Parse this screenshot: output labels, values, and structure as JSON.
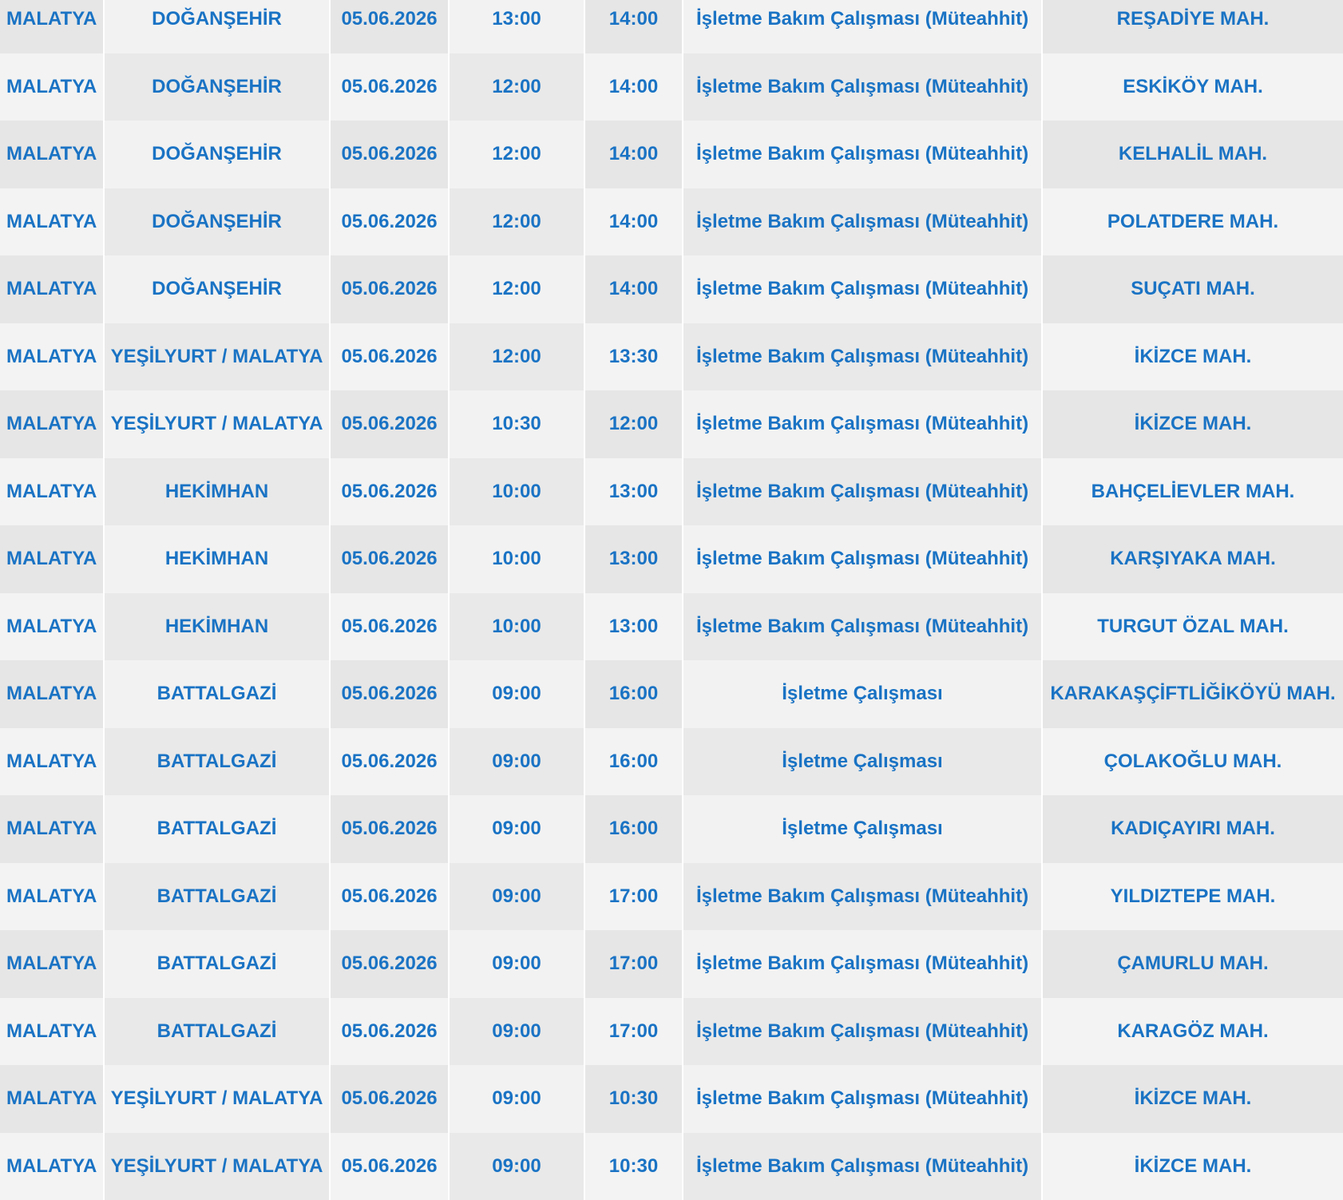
{
  "rows": [
    {
      "il": "MALATYA",
      "ilce": "DOĞANŞEHİR",
      "tarih": "05.06.2026",
      "baslangic": "13:00",
      "bitis": "14:00",
      "neden": "İşletme Bakım Çalışması (Müteahhit)",
      "mahalle": "REŞADİYE MAH."
    },
    {
      "il": "MALATYA",
      "ilce": "DOĞANŞEHİR",
      "tarih": "05.06.2026",
      "baslangic": "12:00",
      "bitis": "14:00",
      "neden": "İşletme Bakım Çalışması (Müteahhit)",
      "mahalle": "ESKİKÖY MAH."
    },
    {
      "il": "MALATYA",
      "ilce": "DOĞANŞEHİR",
      "tarih": "05.06.2026",
      "baslangic": "12:00",
      "bitis": "14:00",
      "neden": "İşletme Bakım Çalışması (Müteahhit)",
      "mahalle": "KELHALİL MAH."
    },
    {
      "il": "MALATYA",
      "ilce": "DOĞANŞEHİR",
      "tarih": "05.06.2026",
      "baslangic": "12:00",
      "bitis": "14:00",
      "neden": "İşletme Bakım Çalışması (Müteahhit)",
      "mahalle": "POLATDERE MAH."
    },
    {
      "il": "MALATYA",
      "ilce": "DOĞANŞEHİR",
      "tarih": "05.06.2026",
      "baslangic": "12:00",
      "bitis": "14:00",
      "neden": "İşletme Bakım Çalışması (Müteahhit)",
      "mahalle": "SUÇATI MAH."
    },
    {
      "il": "MALATYA",
      "ilce": "YEŞİLYURT / MALATYA",
      "tarih": "05.06.2026",
      "baslangic": "12:00",
      "bitis": "13:30",
      "neden": "İşletme Bakım Çalışması (Müteahhit)",
      "mahalle": "İKİZCE MAH."
    },
    {
      "il": "MALATYA",
      "ilce": "YEŞİLYURT / MALATYA",
      "tarih": "05.06.2026",
      "baslangic": "10:30",
      "bitis": "12:00",
      "neden": "İşletme Bakım Çalışması (Müteahhit)",
      "mahalle": "İKİZCE MAH."
    },
    {
      "il": "MALATYA",
      "ilce": "HEKİMHAN",
      "tarih": "05.06.2026",
      "baslangic": "10:00",
      "bitis": "13:00",
      "neden": "İşletme Bakım Çalışması (Müteahhit)",
      "mahalle": "BAHÇELİEVLER MAH."
    },
    {
      "il": "MALATYA",
      "ilce": "HEKİMHAN",
      "tarih": "05.06.2026",
      "baslangic": "10:00",
      "bitis": "13:00",
      "neden": "İşletme Bakım Çalışması (Müteahhit)",
      "mahalle": "KARŞIYAKA MAH."
    },
    {
      "il": "MALATYA",
      "ilce": "HEKİMHAN",
      "tarih": "05.06.2026",
      "baslangic": "10:00",
      "bitis": "13:00",
      "neden": "İşletme Bakım Çalışması (Müteahhit)",
      "mahalle": "TURGUT ÖZAL MAH."
    },
    {
      "il": "MALATYA",
      "ilce": "BATTALGAZİ",
      "tarih": "05.06.2026",
      "baslangic": "09:00",
      "bitis": "16:00",
      "neden": "İşletme Çalışması",
      "mahalle": "KARAKAŞÇİFTLİĞİKÖYÜ MAH."
    },
    {
      "il": "MALATYA",
      "ilce": "BATTALGAZİ",
      "tarih": "05.06.2026",
      "baslangic": "09:00",
      "bitis": "16:00",
      "neden": "İşletme Çalışması",
      "mahalle": "ÇOLAKOĞLU MAH."
    },
    {
      "il": "MALATYA",
      "ilce": "BATTALGAZİ",
      "tarih": "05.06.2026",
      "baslangic": "09:00",
      "bitis": "16:00",
      "neden": "İşletme Çalışması",
      "mahalle": "KADIÇAYIRI MAH."
    },
    {
      "il": "MALATYA",
      "ilce": "BATTALGAZİ",
      "tarih": "05.06.2026",
      "baslangic": "09:00",
      "bitis": "17:00",
      "neden": "İşletme Bakım Çalışması (Müteahhit)",
      "mahalle": "YILDIZTEPE MAH."
    },
    {
      "il": "MALATYA",
      "ilce": "BATTALGAZİ",
      "tarih": "05.06.2026",
      "baslangic": "09:00",
      "bitis": "17:00",
      "neden": "İşletme Bakım Çalışması (Müteahhit)",
      "mahalle": "ÇAMURLU MAH."
    },
    {
      "il": "MALATYA",
      "ilce": "BATTALGAZİ",
      "tarih": "05.06.2026",
      "baslangic": "09:00",
      "bitis": "17:00",
      "neden": "İşletme Bakım Çalışması (Müteahhit)",
      "mahalle": "KARAGÖZ MAH."
    },
    {
      "il": "MALATYA",
      "ilce": "YEŞİLYURT / MALATYA",
      "tarih": "05.06.2026",
      "baslangic": "09:00",
      "bitis": "10:30",
      "neden": "İşletme Bakım Çalışması (Müteahhit)",
      "mahalle": "İKİZCE MAH."
    },
    {
      "il": "MALATYA",
      "ilce": "YEŞİLYURT / MALATYA",
      "tarih": "05.06.2026",
      "baslangic": "09:00",
      "bitis": "10:30",
      "neden": "İşletme Bakım Çalışması (Müteahhit)",
      "mahalle": "İKİZCE MAH."
    }
  ],
  "colors": {
    "text": "#1a73c4",
    "row_light": "#f3f3f3",
    "row_dark": "#e7e7e7",
    "separator": "#ffffff"
  }
}
